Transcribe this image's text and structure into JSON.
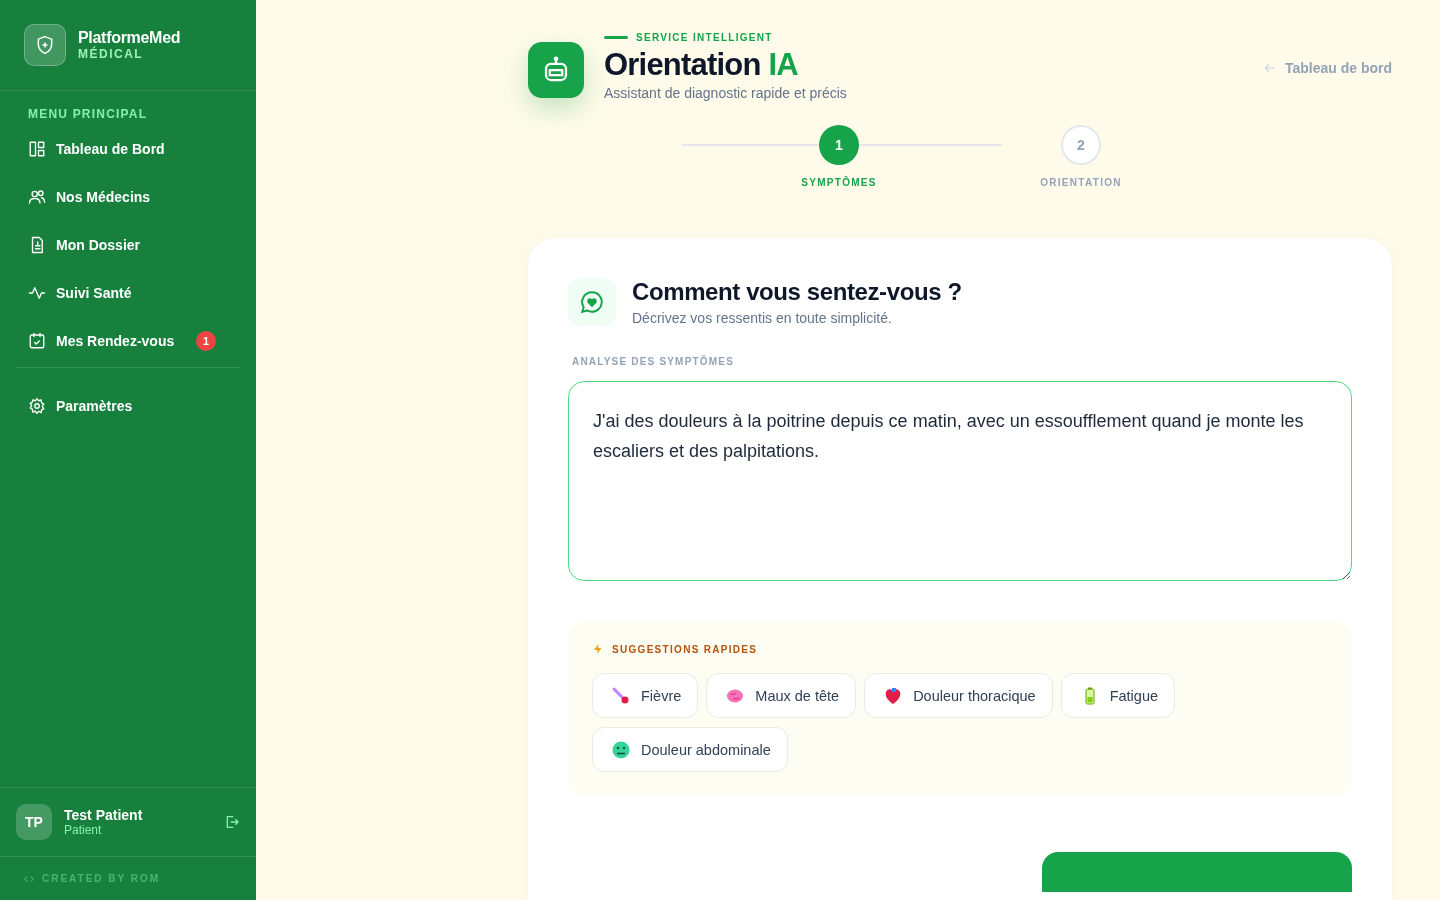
{
  "brand": {
    "name": "PlatformeMed",
    "subtitle": "MÉDICAL"
  },
  "sidebar": {
    "section_title": "MENU PRINCIPAL",
    "items": [
      {
        "label": "Tableau de Bord",
        "kind": "layout",
        "selected": false
      },
      {
        "label": "Nos Médecins",
        "kind": "users",
        "selected": false
      },
      {
        "label": "Mon Dossier",
        "kind": "file",
        "selected": false
      },
      {
        "label": "Suivi Santé",
        "kind": "pulse",
        "selected": false
      },
      {
        "label": "Mes Rendez-vous",
        "kind": "calendar",
        "selected": false,
        "badge": "1"
      }
    ],
    "footer_items": [
      {
        "label": "Paramètres",
        "kind": "gear",
        "selected": false
      }
    ],
    "user": {
      "initials": "TP",
      "name": "Test Patient",
      "role": "Patient"
    },
    "credit": "CREATED BY ROM"
  },
  "header": {
    "eyebrow": "SERVICE INTELLIGENT",
    "title": "Orientation",
    "title_accent": "IA",
    "subtitle": "Assistant de diagnostic rapide et précis",
    "back_link": "Tableau de bord"
  },
  "steps": [
    {
      "number": "1",
      "label": "SYMPTÔMES",
      "selected": true
    },
    {
      "number": "2",
      "label": "ORIENTATION",
      "selected": false
    }
  ],
  "card": {
    "title": "Comment vous sentez-vous ?",
    "subtitle": "Décrivez vos ressentis en toute simplicité.",
    "field_label": "ANALYSE DES SYMPTÔMES",
    "symptoms_value": "J'ai des douleurs à la poitrine depuis ce matin, avec un essoufflement quand je monte les escaliers et des palpitations.",
    "suggestions_title": "SUGGESTIONS RAPIDES",
    "suggestions": [
      {
        "label": "Fièvre",
        "kind": "thermometer"
      },
      {
        "label": "Maux de tête",
        "kind": "brain"
      },
      {
        "label": "Douleur thoracique",
        "kind": "heart"
      },
      {
        "label": "Fatigue",
        "kind": "battery"
      },
      {
        "label": "Douleur abdominale",
        "kind": "face"
      }
    ]
  }
}
